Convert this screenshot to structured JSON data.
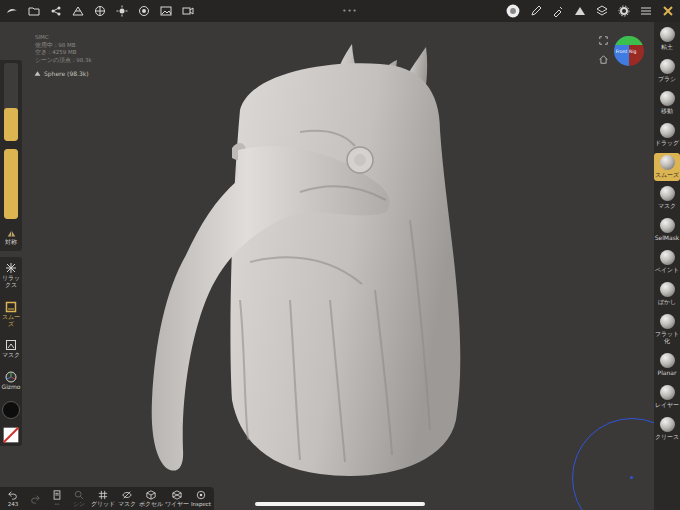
{
  "top_bar": {
    "handle": "•••"
  },
  "info": {
    "lines": [
      "SIMC",
      "使用中 : 98 MB",
      "空き : 4259 MB",
      "シーンの頂点 : 98.3k"
    ]
  },
  "scene": {
    "object": "Sphere (98.3k)"
  },
  "gizmo": {
    "front": "Front",
    "right": "Rig"
  },
  "left_panel": {
    "sliders": [
      {
        "level": 0.42
      },
      {
        "level": 1.0
      }
    ],
    "symmetry": {
      "label": "対称",
      "on": false
    },
    "tools": [
      {
        "label": "リラックス",
        "selected": false
      },
      {
        "label": "スムーズ",
        "selected": true
      },
      {
        "label": "マスク",
        "selected": false
      },
      {
        "label": "Gizmo",
        "selected": false
      }
    ]
  },
  "right_tools": [
    {
      "label": "粘土",
      "selected": false
    },
    {
      "label": "ブラシ",
      "selected": false
    },
    {
      "label": "移動",
      "selected": false
    },
    {
      "label": "ドラッグ",
      "selected": false
    },
    {
      "label": "スムーズ",
      "selected": true
    },
    {
      "label": "マスク",
      "selected": false
    },
    {
      "label": "SelMask",
      "selected": false
    },
    {
      "label": "ペイント",
      "selected": false
    },
    {
      "label": "ぼかし",
      "selected": false
    },
    {
      "label": "フラット化",
      "selected": false
    },
    {
      "label": "Planar",
      "selected": false
    },
    {
      "label": "レイヤー",
      "selected": false
    },
    {
      "label": "クリース",
      "selected": false
    }
  ],
  "bottom_bar": [
    {
      "label": "243",
      "disabled": false
    },
    {
      "disabled": true
    },
    {
      "label": "···",
      "disabled": false
    },
    {
      "label": "シン",
      "disabled": true
    },
    {
      "label": "グリッド",
      "disabled": false
    },
    {
      "label": "マスク",
      "disabled": false
    },
    {
      "label": "ボクセル",
      "disabled": false
    },
    {
      "label": "ワイヤー",
      "disabled": false
    },
    {
      "label": "Inspect",
      "disabled": false
    }
  ]
}
